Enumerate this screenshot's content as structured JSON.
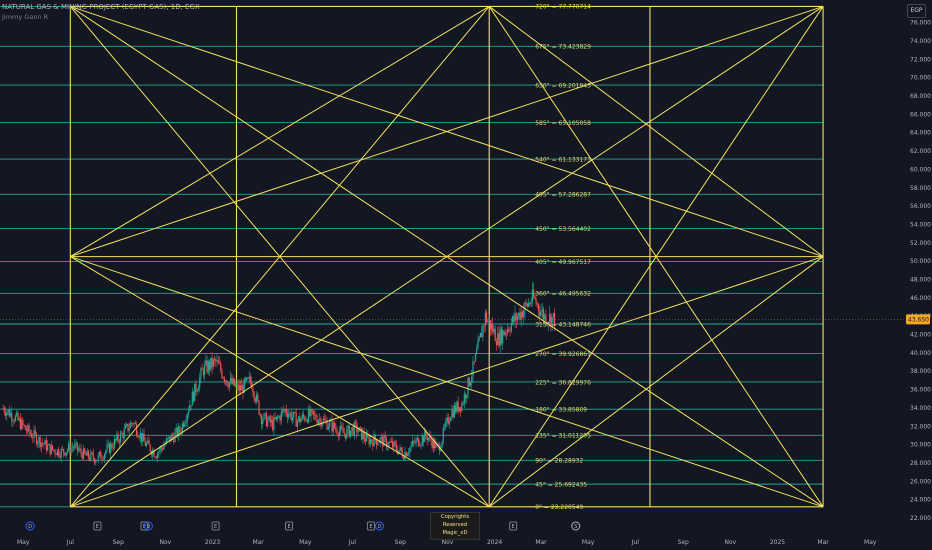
{
  "header": {
    "title": "NATURAL GAS & MINING PROJECT (EGYPT GAS), 1D, EGX",
    "indicator": "Jimmy Gann R"
  },
  "currency": "EGP",
  "copyright": [
    "Copyrights Reserved",
    "Magic_xD"
  ],
  "colors": {
    "bg": "#131722",
    "gann_line": "#f5e15d",
    "level_line": "#26a69a",
    "level_text": "#e8d86a",
    "up": "#26a69a",
    "down": "#ef5350",
    "price_tag": "#f5a623",
    "axis_text": "#b2b5be"
  },
  "chart_data": {
    "type": "candlestick",
    "title": "NATURAL GAS & MINING PROJECT (EGYPT GAS), 1D, EGX",
    "ylim": [
      22,
      77.6
    ],
    "y_ticks": [
      22,
      24,
      26,
      28,
      30,
      32,
      34,
      36,
      38,
      40,
      42,
      44,
      46,
      48,
      50,
      52,
      54,
      56,
      58,
      60,
      62,
      64,
      66,
      68,
      70,
      72,
      74,
      76
    ],
    "y_tick_labels": [
      "22.000",
      "24.000",
      "26.000",
      "28.000",
      "30.000",
      "32.000",
      "34.000",
      "36.000",
      "38.000",
      "40.000",
      "42.000",
      "44.000",
      "46.000",
      "48.000",
      "50.000",
      "52.000",
      "54.000",
      "56.000",
      "58.000",
      "60.000",
      "62.000",
      "64.000",
      "66.000",
      "68.000",
      "70.000",
      "72.000",
      "74.000",
      "76.000"
    ],
    "x_labels": [
      {
        "label": "May",
        "date": "2022-05-01"
      },
      {
        "label": "Jul",
        "date": "2022-07-01"
      },
      {
        "label": "Sep",
        "date": "2022-09-01"
      },
      {
        "label": "Nov",
        "date": "2022-11-01"
      },
      {
        "label": "2023",
        "date": "2023-01-01"
      },
      {
        "label": "Mar",
        "date": "2023-03-01"
      },
      {
        "label": "May",
        "date": "2023-05-01"
      },
      {
        "label": "Jul",
        "date": "2023-07-01"
      },
      {
        "label": "Sep",
        "date": "2023-09-01"
      },
      {
        "label": "Nov",
        "date": "2023-11-01"
      },
      {
        "label": "2024",
        "date": "2024-01-01"
      },
      {
        "label": "Mar",
        "date": "2024-03-01"
      },
      {
        "label": "May",
        "date": "2024-05-01"
      },
      {
        "label": "Jul",
        "date": "2024-07-01"
      },
      {
        "label": "Sep",
        "date": "2024-09-01"
      },
      {
        "label": "Nov",
        "date": "2024-11-01"
      },
      {
        "label": "2025",
        "date": "2025-01-01"
      },
      {
        "label": "Mar",
        "date": "2025-03-01"
      },
      {
        "label": "May",
        "date": "2025-05-01"
      }
    ],
    "gann_levels": [
      {
        "label": "720° = 77.770714",
        "value": 77.770714
      },
      {
        "label": "675° = 73.423829",
        "value": 73.423829
      },
      {
        "label": "630° = 69.201943",
        "value": 69.201943
      },
      {
        "label": "585° = 65.105058",
        "value": 65.105058
      },
      {
        "label": "540° = 61.133173",
        "value": 61.133173
      },
      {
        "label": "495° = 57.286287",
        "value": 57.286287
      },
      {
        "label": "450° = 53.564402",
        "value": 53.564402
      },
      {
        "label": "405° = 49.967517",
        "value": 49.967517
      },
      {
        "label": "360° = 46.495632",
        "value": 46.495632
      },
      {
        "label": "315° = 43.148746",
        "value": 43.148746
      },
      {
        "label": "270° = 39.926861",
        "value": 39.926861
      },
      {
        "label": "225° = 36.829976",
        "value": 36.829976
      },
      {
        "label": "180° = 33.85809",
        "value": 33.85809
      },
      {
        "label": "135° = 31.011205",
        "value": 31.011205
      },
      {
        "label": "90° = 28.28932",
        "value": 28.28932
      },
      {
        "label": "45° = 25.692435",
        "value": 25.692435
      },
      {
        "label": "0° = 23.220549",
        "value": 23.220549
      }
    ],
    "gann_grid": {
      "time_lines": [
        "2022-07-01",
        "2023-02-01",
        "2023-12-25",
        "2024-07-20",
        "2025-03-01"
      ],
      "price_low": 23.220549,
      "price_mid": 50.5,
      "price_high": 77.770714
    },
    "last_price": 43.65,
    "last_price_label": "43.650",
    "closes": [
      [
        "2022-04-05",
        34.0
      ],
      [
        "2022-04-20",
        33.0
      ],
      [
        "2022-05-05",
        31.6
      ],
      [
        "2022-05-20",
        30.6
      ],
      [
        "2022-06-05",
        29.5
      ],
      [
        "2022-06-20",
        29.2
      ],
      [
        "2022-07-05",
        29.8
      ],
      [
        "2022-07-20",
        28.8
      ],
      [
        "2022-08-05",
        28.5
      ],
      [
        "2022-08-20",
        29.6
      ],
      [
        "2022-09-05",
        31.0
      ],
      [
        "2022-09-20",
        32.5
      ],
      [
        "2022-10-05",
        30.2
      ],
      [
        "2022-10-20",
        29.0
      ],
      [
        "2022-11-05",
        30.5
      ],
      [
        "2022-11-20",
        31.5
      ],
      [
        "2022-12-05",
        35.0
      ],
      [
        "2022-12-20",
        38.2
      ],
      [
        "2023-01-05",
        39.0
      ],
      [
        "2023-01-20",
        37.0
      ],
      [
        "2023-02-05",
        36.0
      ],
      [
        "2023-02-20",
        37.0
      ],
      [
        "2023-03-05",
        33.0
      ],
      [
        "2023-03-20",
        32.2
      ],
      [
        "2023-04-05",
        33.8
      ],
      [
        "2023-04-20",
        32.6
      ],
      [
        "2023-05-05",
        33.2
      ],
      [
        "2023-05-20",
        32.8
      ],
      [
        "2023-06-05",
        32.0
      ],
      [
        "2023-06-20",
        31.2
      ],
      [
        "2023-07-05",
        31.8
      ],
      [
        "2023-07-20",
        30.5
      ],
      [
        "2023-08-05",
        30.5
      ],
      [
        "2023-08-20",
        30.0
      ],
      [
        "2023-09-05",
        29.0
      ],
      [
        "2023-09-20",
        30.2
      ],
      [
        "2023-10-05",
        31.0
      ],
      [
        "2023-10-20",
        29.5
      ],
      [
        "2023-11-05",
        33.5
      ],
      [
        "2023-11-20",
        34.5
      ],
      [
        "2023-12-05",
        38.5
      ],
      [
        "2023-12-20",
        44.0
      ],
      [
        "2024-01-05",
        41.5
      ],
      [
        "2024-01-20",
        43.0
      ],
      [
        "2024-02-05",
        44.5
      ],
      [
        "2024-02-20",
        46.0
      ],
      [
        "2024-03-05",
        44.0
      ],
      [
        "2024-03-20",
        43.65
      ]
    ],
    "x_range": [
      "2022-04-01",
      "2025-06-15"
    ]
  },
  "event_markers": [
    {
      "date": "2022-05-10",
      "glyph": "D"
    },
    {
      "date": "2022-08-05",
      "glyph": "E"
    },
    {
      "date": "2022-10-05",
      "glyph": "E"
    },
    {
      "date": "2022-10-10",
      "glyph": "D"
    },
    {
      "date": "2023-01-05",
      "glyph": "E"
    },
    {
      "date": "2023-04-10",
      "glyph": "E"
    },
    {
      "date": "2023-07-25",
      "glyph": "E"
    },
    {
      "date": "2023-08-05",
      "glyph": "D"
    },
    {
      "date": "2023-10-20",
      "glyph": "E"
    },
    {
      "date": "2024-01-25",
      "glyph": "E"
    },
    {
      "date": "2024-04-15",
      "glyph": "S"
    }
  ]
}
